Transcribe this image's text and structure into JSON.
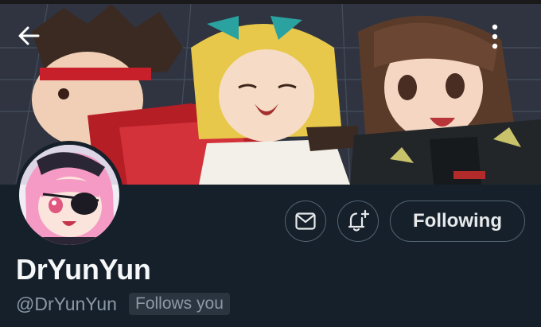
{
  "profile": {
    "display_name": "DrYunYun",
    "handle": "@DrYunYun",
    "follows_you_badge": "Follows you"
  },
  "actions": {
    "follow_state_label": "Following",
    "message_icon": "envelope-icon",
    "notify_icon": "bell-plus-icon"
  },
  "nav": {
    "back_icon": "arrow-left-icon",
    "more_icon": "vertical-ellipsis-icon"
  },
  "colors": {
    "background": "#15202b",
    "text_primary": "#e7e9ea",
    "text_secondary": "#8b98a5",
    "border": "#536471"
  }
}
